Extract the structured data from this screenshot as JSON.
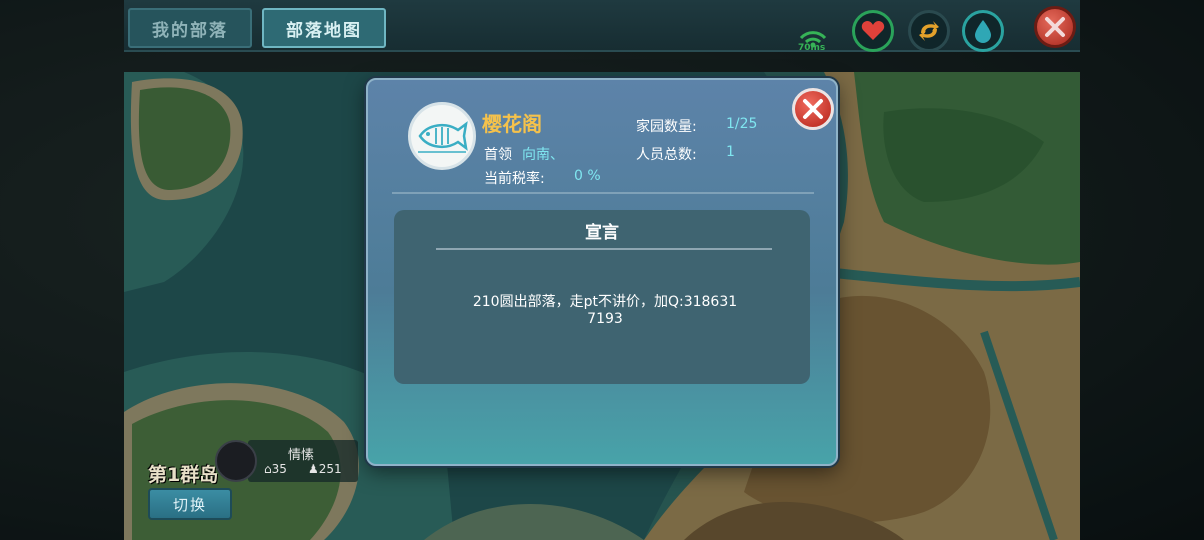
{
  "tabs": {
    "my_tribe": "我的部落",
    "tribe_map": "部落地图"
  },
  "status": {
    "ping": "70ms",
    "icons": [
      "wifi-icon",
      "heart-icon",
      "stamina-icon",
      "water-drop-icon",
      "close-icon"
    ],
    "colors": {
      "heart": "#e0413a",
      "stamina": "#e3a12b",
      "water": "#2fa7b5",
      "ping": "#36b357"
    }
  },
  "map": {
    "island_label": "第1群岛",
    "switch_label": "切换",
    "tribe_plate": {
      "name": "情愫",
      "homes": "35",
      "people": "251"
    }
  },
  "dialog": {
    "tribe_name": "樱花阁",
    "leader_label": "首领",
    "leader_value": "向南、",
    "tax_label": "当前税率:",
    "tax_value": "0 %",
    "homes_label": "家园数量:",
    "homes_value": "1/25",
    "members_label": "人员总数:",
    "members_value": "1",
    "declaration": {
      "title": "宣言",
      "text_line1": "210圆出部落，走pt不讲价，加Q:318631",
      "text_line2": "7193"
    },
    "emblem_icon": "fish-emblem-icon",
    "colors": {
      "name": "#f5c24b",
      "value": "#7fe6f0"
    }
  }
}
